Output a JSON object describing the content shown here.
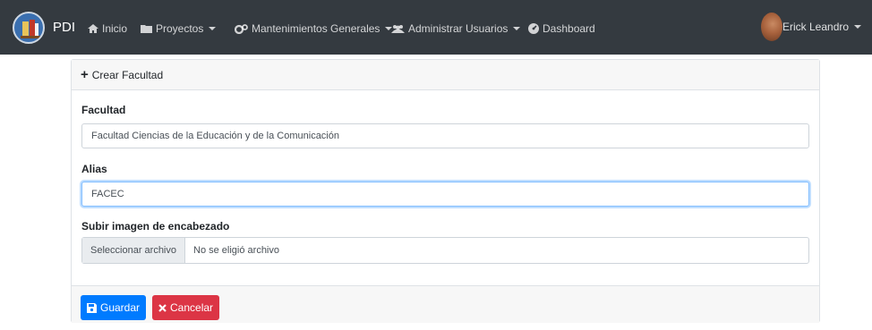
{
  "navbar": {
    "brand": "PDI",
    "items": [
      {
        "label": "Inicio",
        "icon": "home-icon",
        "dropdown": false
      },
      {
        "label": "Proyectos",
        "icon": "folder-icon",
        "dropdown": true
      },
      {
        "label": "Mantenimientos Generales",
        "icon": "gears-icon",
        "dropdown": true
      },
      {
        "label": "Administrar Usuarios",
        "icon": "users-icon",
        "dropdown": true
      },
      {
        "label": "Dashboard",
        "icon": "dashboard-icon",
        "dropdown": false
      }
    ],
    "user": "Erick Leandro"
  },
  "card": {
    "title": "Crear Facultad",
    "fields": {
      "facultad_label": "Facultad",
      "facultad_value": "Facultad Ciencias de la Educación y de la Comunicación",
      "alias_label": "Alias",
      "alias_value": "FACEC",
      "imagen_label": "Subir imagen de encabezado",
      "file_button": "Seleccionar archivo",
      "file_status": "No se eligió archivo"
    },
    "save_label": "Guardar",
    "cancel_label": "Cancelar"
  },
  "colors": {
    "navbar": "#343a40",
    "primary": "#007bff",
    "danger": "#dc3545"
  }
}
